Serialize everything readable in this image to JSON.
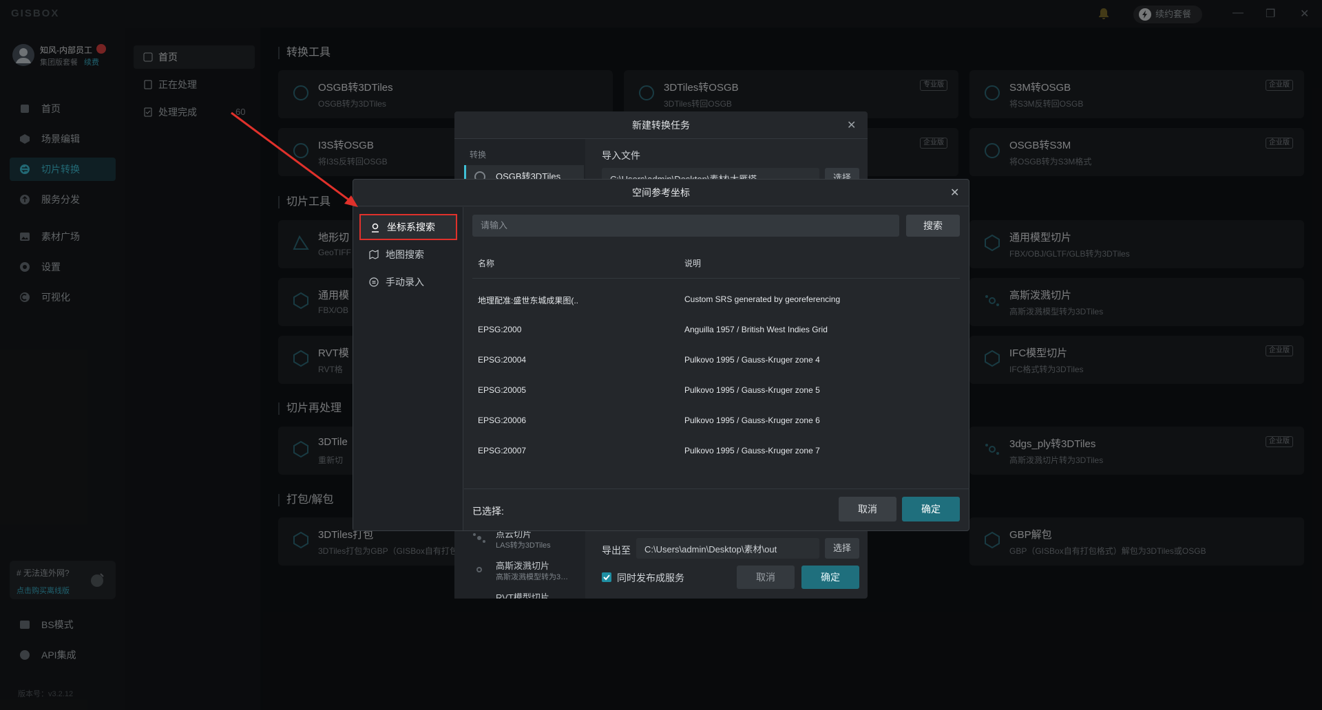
{
  "app": {
    "logo": "GISBOX",
    "renew_label": "续约套餐"
  },
  "user": {
    "name": "知风-内部员工",
    "plan": "集团版套餐",
    "renew_link": "续费"
  },
  "sidebar": {
    "items": [
      {
        "label": "首页",
        "icon": "home-icon"
      },
      {
        "label": "场景编辑",
        "icon": "scene-edit-icon"
      },
      {
        "label": "切片转换",
        "icon": "convert-icon"
      },
      {
        "label": "服务分发",
        "icon": "cloud-upload-icon"
      },
      {
        "label": "素材广场",
        "icon": "image-icon"
      },
      {
        "label": "设置",
        "icon": "gear-icon"
      },
      {
        "label": "可视化",
        "icon": "chart-icon"
      }
    ],
    "net_card": {
      "title": "# 无法连外网?",
      "link": "点击购买离线版"
    },
    "bottom_items": [
      {
        "label": "BS模式",
        "icon": "browser-icon"
      },
      {
        "label": "API集成",
        "icon": "api-icon"
      }
    ],
    "version": "版本号：v3.2.12"
  },
  "subnav": {
    "items": [
      {
        "label": "首页"
      },
      {
        "label": "正在处理"
      },
      {
        "label": "处理完成"
      }
    ],
    "done_count": "60"
  },
  "main": {
    "sections": [
      "转换工具",
      "切片工具",
      "切片再处理",
      "打包/解包"
    ],
    "cards": [
      {
        "title": "OSGB转3DTiles",
        "sub": "OSGB转为3DTiles",
        "badge": ""
      },
      {
        "title": "3DTiles转OSGB",
        "sub": "3DTiles转回OSGB",
        "badge": "专业版"
      },
      {
        "title": "S3M转OSGB",
        "sub": "将S3M反转回OSGB",
        "badge": "企业版"
      },
      {
        "title": "I3S转OSGB",
        "sub": "将I3S反转回OSGB",
        "badge": "企业版"
      },
      {
        "title": "OSGB转S3M",
        "sub": "将OSGB转为S3M格式",
        "badge": "企业版"
      },
      {
        "title": "地形切",
        "sub": "GeoTIFF",
        "badge": ""
      },
      {
        "title": "通用模型切片",
        "sub": "FBX/OBJ/GLTF/GLB转为3DTiles",
        "badge": ""
      },
      {
        "title": "通用模",
        "sub": "FBX/OB",
        "badge": ""
      },
      {
        "title": "高斯泼溅切片",
        "sub": "高斯泼溅模型转为3DTiles",
        "badge": ""
      },
      {
        "title": "RVT模",
        "sub": "RVT格",
        "badge": ""
      },
      {
        "title": "IFC模型切片",
        "sub": "IFC格式转为3DTiles",
        "badge": "企业版"
      },
      {
        "title": "3DTile",
        "sub": "重新切",
        "badge": ""
      },
      {
        "title": "3dgs_ply转3DTiles",
        "sub": "高斯泼溅切片转为3DTiles",
        "badge": "企业版"
      },
      {
        "title": "3DTiles打包",
        "sub": "3DTiles打包为GBP（GISBox自有打包格式）",
        "badge": ""
      },
      {
        "title": "GBP解包",
        "sub": "GBP（GISBox自有打包格式）解包为3DTiles或OSGB",
        "badge": ""
      }
    ]
  },
  "task_dialog": {
    "title": "新建转换任务",
    "convert_label": "转换",
    "selected_tool": "OSGB转3DTiles",
    "import_label": "导入文件",
    "import_value": "C:\\Users\\admin\\Desktop\\素材\\大雁塔",
    "select_label": "选择",
    "list": [
      {
        "title": "点云切片",
        "sub": "LAS转为3DTiles"
      },
      {
        "title": "高斯泼溅切片",
        "sub": "高斯泼溅模型转为3…"
      },
      {
        "title": "RVT模型切片",
        "sub": ""
      }
    ],
    "export_label": "导出至",
    "export_value": "C:\\Users\\admin\\Desktop\\素材\\out",
    "publish_label": "同时发布成服务",
    "cancel": "取消",
    "ok": "确定"
  },
  "srs_dialog": {
    "title": "空间参考坐标",
    "tabs": [
      {
        "label": "坐标系搜索",
        "icon": "location-pin-icon"
      },
      {
        "label": "地图搜索",
        "icon": "map-icon"
      },
      {
        "label": "手动录入",
        "icon": "edit-circle-icon"
      }
    ],
    "search_placeholder": "请输入",
    "search_button": "搜索",
    "columns": [
      "名称",
      "说明"
    ],
    "rows": [
      {
        "name": "地理配准:盛世东城成果图(..",
        "desc": "Custom SRS generated by georeferencing"
      },
      {
        "name": "EPSG:2000",
        "desc": "Anguilla 1957 / British West Indies Grid"
      },
      {
        "name": "EPSG:20004",
        "desc": "Pulkovo 1995 / Gauss-Kruger zone 4"
      },
      {
        "name": "EPSG:20005",
        "desc": "Pulkovo 1995 / Gauss-Kruger zone 5"
      },
      {
        "name": "EPSG:20006",
        "desc": "Pulkovo 1995 / Gauss-Kruger zone 6"
      },
      {
        "name": "EPSG:20007",
        "desc": "Pulkovo 1995 / Gauss-Kruger zone 7"
      }
    ],
    "selected_label": "已选择:",
    "cancel": "取消",
    "ok": "确定"
  },
  "colors": {
    "accent": "#3fc0d6",
    "primary_button": "#1f6f7d",
    "highlight_border": "#e0312b",
    "arrow": "#e0312b"
  }
}
